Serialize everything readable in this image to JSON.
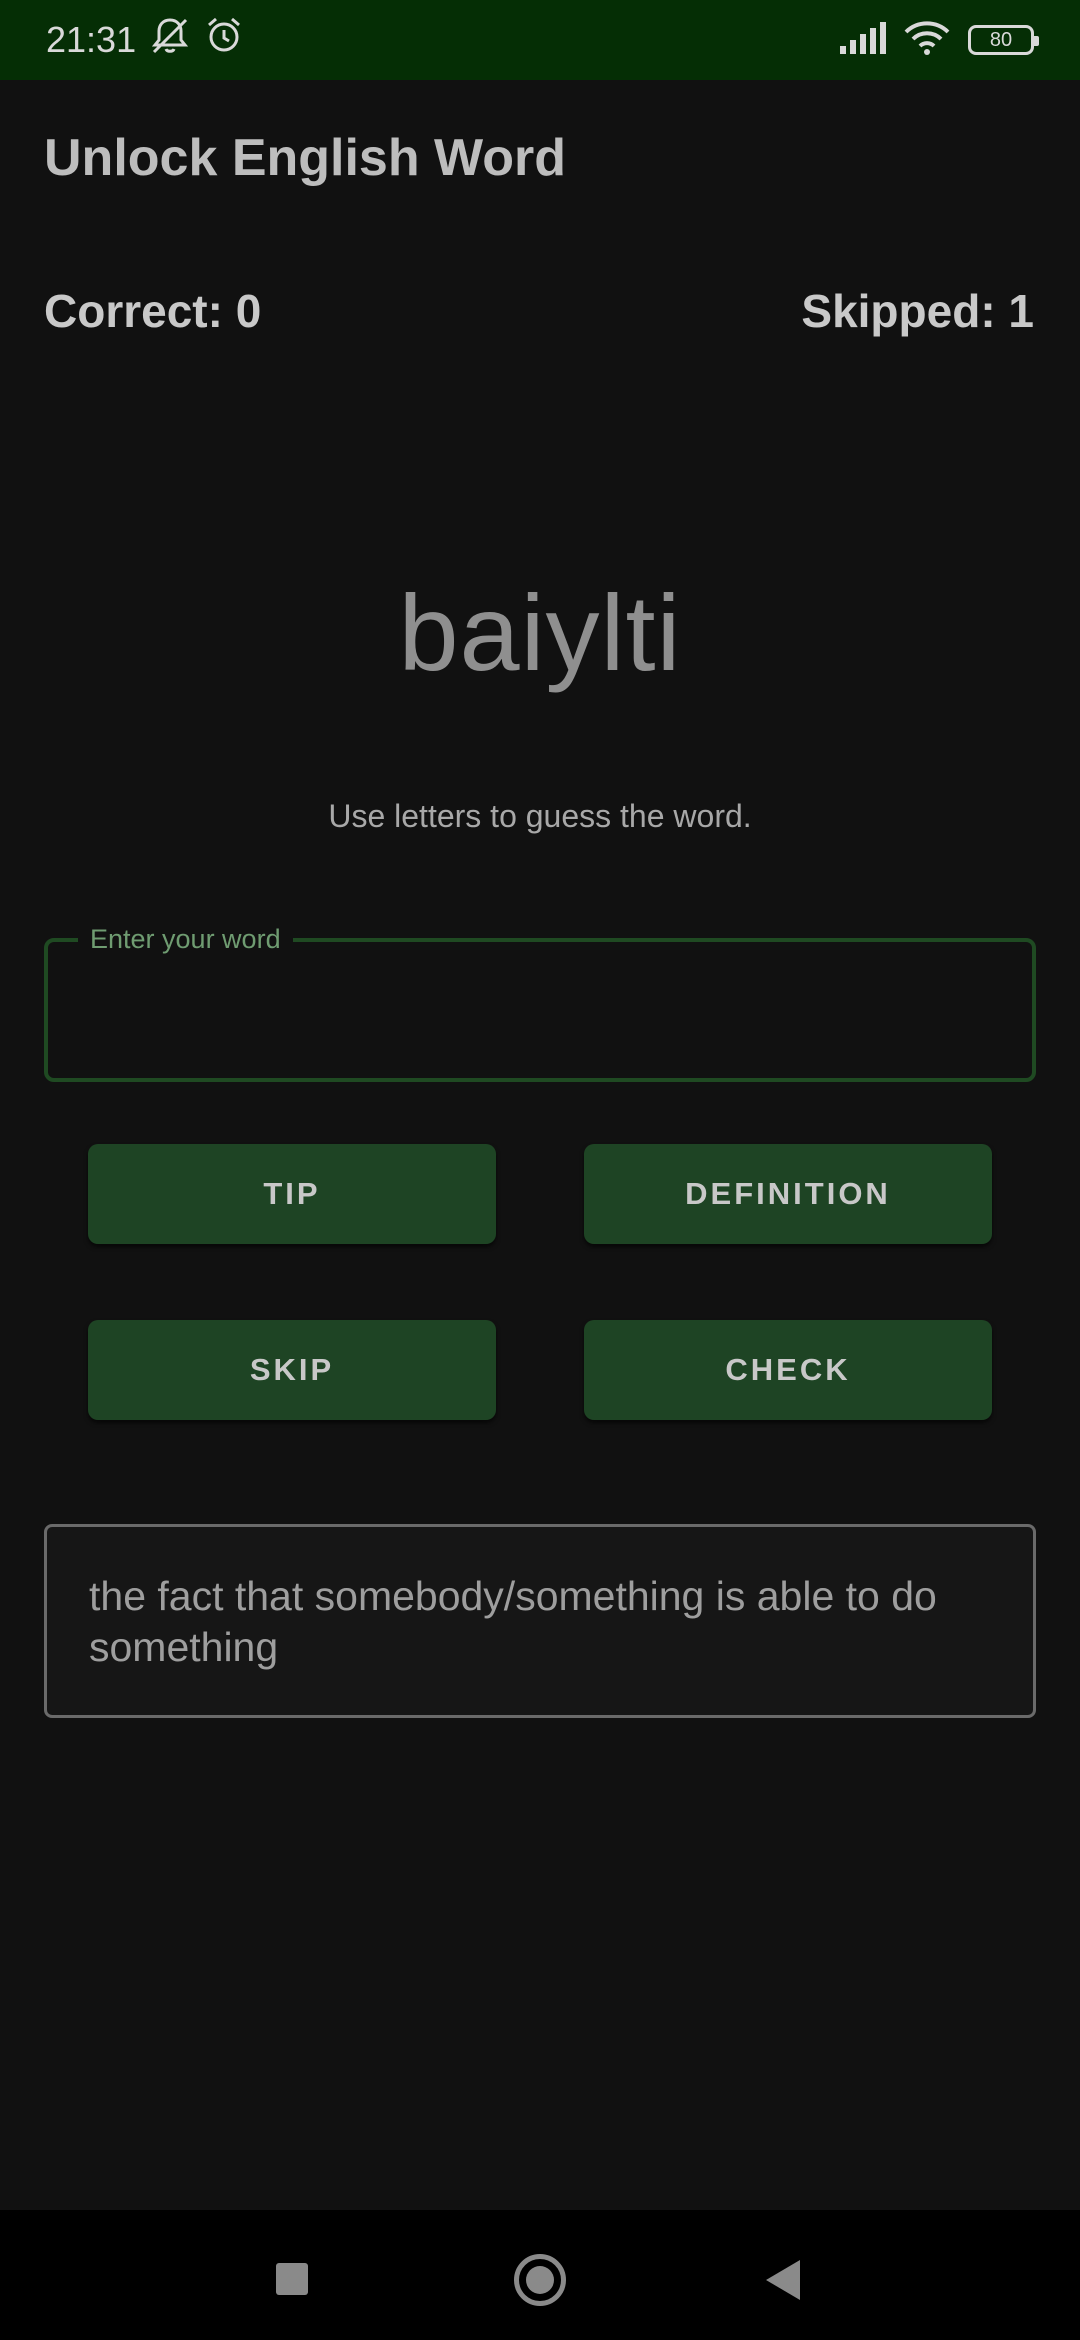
{
  "status_bar": {
    "time": "21:31",
    "icons": [
      "mute-icon",
      "alarm-icon",
      "signal-icon",
      "wifi-icon"
    ],
    "battery": "80"
  },
  "app": {
    "title": "Unlock English Word"
  },
  "score": {
    "correct": "Correct: 0",
    "skipped": "Skipped: 1"
  },
  "puzzle": {
    "scrambled_word": "baiylti",
    "instruction": "Use letters to guess the word."
  },
  "input": {
    "label": "Enter your word",
    "value": "",
    "placeholder": ""
  },
  "buttons": {
    "tip": "TIP",
    "definition": "DEFINITION",
    "skip": "SKIP",
    "check": "CHECK"
  },
  "definition": {
    "text": "the fact that somebody/something is able to do something"
  },
  "colors": {
    "status_bar": "#052e05",
    "background": "#111111",
    "button": "#1e4424",
    "field_border": "#1f4a22"
  }
}
